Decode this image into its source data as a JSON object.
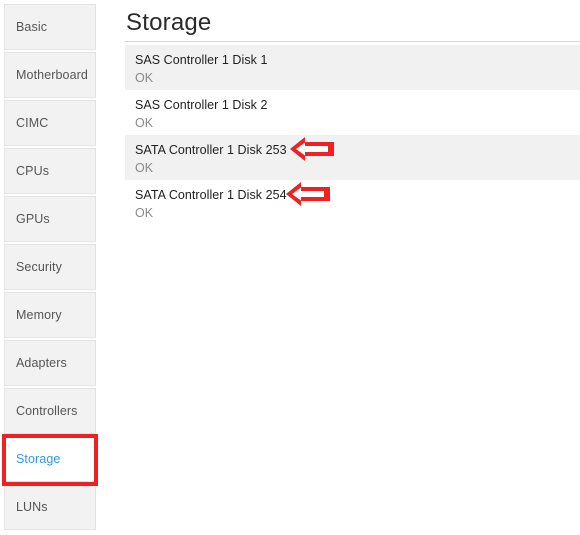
{
  "sidebar": {
    "items": [
      {
        "label": "Basic",
        "selected": false
      },
      {
        "label": "Motherboard",
        "selected": false
      },
      {
        "label": "CIMC",
        "selected": false
      },
      {
        "label": "CPUs",
        "selected": false
      },
      {
        "label": "GPUs",
        "selected": false
      },
      {
        "label": "Security",
        "selected": false
      },
      {
        "label": "Memory",
        "selected": false
      },
      {
        "label": "Adapters",
        "selected": false
      },
      {
        "label": "Controllers",
        "selected": false
      },
      {
        "label": "Storage",
        "selected": true
      },
      {
        "label": "LUNs",
        "selected": false
      }
    ],
    "selected_label": "Storage",
    "selected_text_color": "#3399dd",
    "tile_background": "#f2f2f2"
  },
  "main": {
    "title": "Storage",
    "devices": [
      {
        "name": "SAS Controller 1 Disk 1",
        "status": "OK",
        "shaded": true,
        "arrow": false
      },
      {
        "name": "SAS Controller 1 Disk 2",
        "status": "OK",
        "shaded": false,
        "arrow": false
      },
      {
        "name": "SATA Controller 1 Disk 253",
        "status": "OK",
        "shaded": true,
        "arrow": true
      },
      {
        "name": "SATA Controller 1 Disk 254",
        "status": "OK",
        "shaded": false,
        "arrow": true
      }
    ]
  },
  "annotations": {
    "color": "#ee2222",
    "arrow_direction": "left",
    "arrow_count": 2,
    "highlight_target": "Storage"
  }
}
